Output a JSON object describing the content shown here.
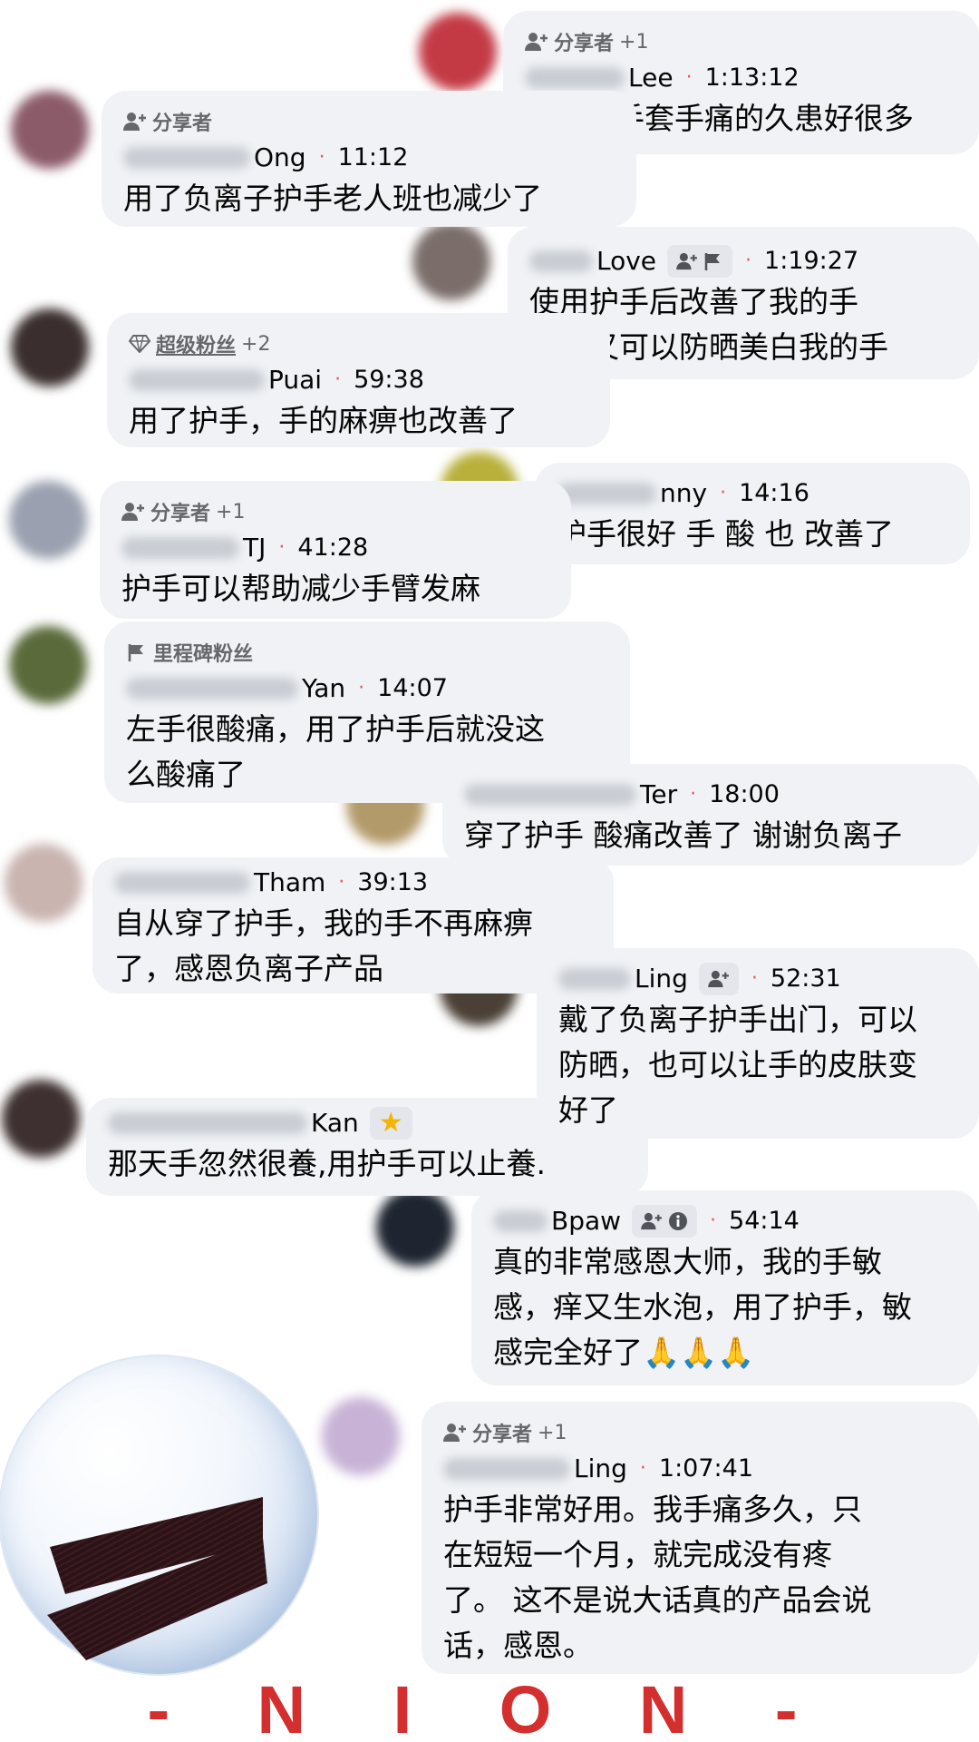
{
  "comments": [
    {
      "id": "c1",
      "badge": "分享者",
      "badge_extra": "+1",
      "name": "Lee",
      "time": "1:13:12",
      "text": "用了护手套手痛的久患好很多"
    },
    {
      "id": "c2",
      "badge": "分享者",
      "badge_extra": "",
      "name": "Ong",
      "time": "11:12",
      "text": "用了负离子护手老人班也减少了"
    },
    {
      "id": "c3",
      "badge": "",
      "badge_extra": "",
      "name": "Love",
      "time": "1:19:27",
      "text": "使用护手后改善了我的手\n痛，又可以防晒美白我的手"
    },
    {
      "id": "c4",
      "badge": "超级粉丝",
      "badge_extra": "+2",
      "name": "Puai",
      "time": "59:38",
      "text": "用了护手，手的麻痹也改善了"
    },
    {
      "id": "c5",
      "badge": "",
      "badge_extra": "",
      "name": "nny",
      "time": "14:16",
      "text": "护手很好 手 酸 也 改善了"
    },
    {
      "id": "c6",
      "badge": "分享者",
      "badge_extra": "+1",
      "name": "TJ",
      "time": "41:28",
      "text": "护手可以帮助减少手臂发麻"
    },
    {
      "id": "c7",
      "badge": "里程碑粉丝",
      "badge_extra": "",
      "name": "Yan",
      "time": "14:07",
      "text": "左手很酸痛，用了护手后就没这\n么酸痛了"
    },
    {
      "id": "c8",
      "badge": "",
      "badge_extra": "",
      "name": "Ter",
      "time": "18:00",
      "text": "穿了护手 酸痛改善了 谢谢负离子"
    },
    {
      "id": "c9",
      "badge": "",
      "badge_extra": "",
      "name": "Tham",
      "time": "39:13",
      "text": "自从穿了护手，我的手不再麻痹\n了，感恩负离子产品"
    },
    {
      "id": "c10",
      "badge": "",
      "badge_extra": "",
      "name": "Ling",
      "time": "52:31",
      "text": "戴了负离子护手出门，可以\n防晒，也可以让手的皮肤变\n好了"
    },
    {
      "id": "c11",
      "badge": "",
      "badge_extra": "",
      "name": "Kan",
      "time": "",
      "text": "那天手忽然很養,用护手可以止養."
    },
    {
      "id": "c12",
      "badge": "",
      "badge_extra": "",
      "name": "Bpaw",
      "time": "54:14",
      "text": "真的非常感恩大师，我的手敏\n感，痒又生水泡，用了护手，敏\n感完全好了🙏🙏🙏"
    },
    {
      "id": "c13",
      "badge": "分享者",
      "badge_extra": "+1",
      "name": "Ling",
      "time": "1:07:41",
      "text": "护手非常好用。我手痛多久，只\n在短短一个月，就完成没有疼\n了。 这不是说大话真的产品会说\n话，感恩。"
    }
  ],
  "brand": "- N I O N -",
  "icons": {
    "sharer": "person-add-icon",
    "super_fan": "diamond-icon",
    "milestone": "flag-icon",
    "product": "arm-sleeve-product"
  },
  "colors": {
    "bubble": "#f0f2f5",
    "brand": "#d32f2f",
    "meta_dot": "#e65a5a",
    "muted": "#65676b"
  }
}
